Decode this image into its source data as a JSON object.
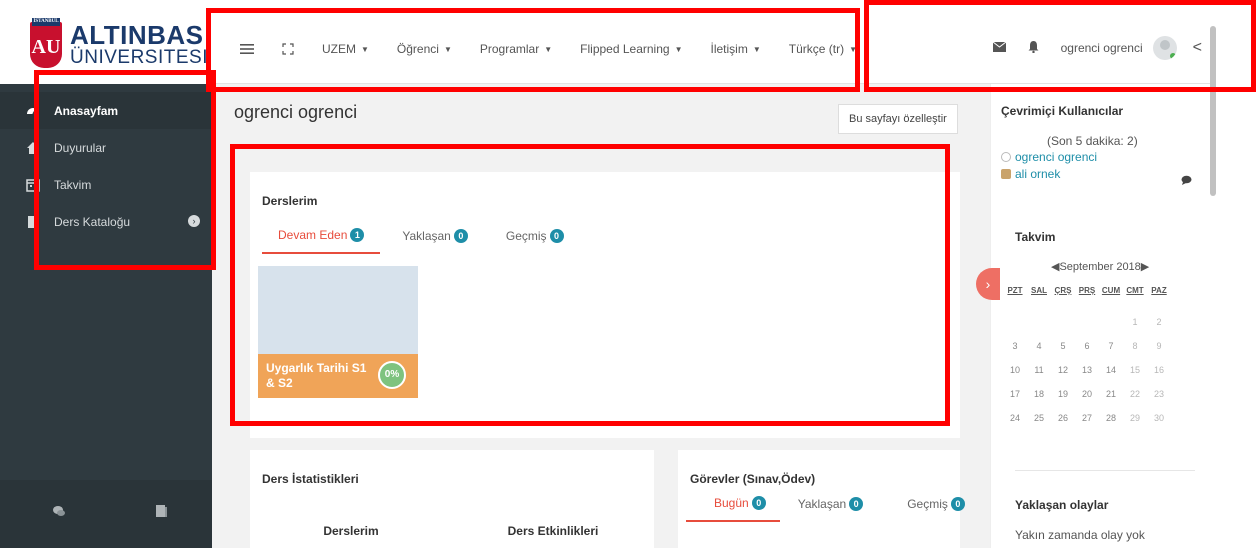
{
  "brand": {
    "name": "ALTINBAS",
    "sub": "ÜNIVERSITESI",
    "mark": "AU",
    "crown": "İSTANBUL"
  },
  "sidebar": {
    "items": [
      {
        "label": "Anasayfam",
        "icon": "dashboard-icon",
        "active": true
      },
      {
        "label": "Duyurular",
        "icon": "home-icon",
        "active": false
      },
      {
        "label": "Takvim",
        "icon": "calendar-icon",
        "active": false
      },
      {
        "label": "Ders Kataloğu",
        "icon": "book-icon",
        "active": false
      }
    ]
  },
  "topbar": {
    "menu": [
      "UZEM",
      "Öğrenci",
      "Programlar",
      "Flipped Learning",
      "İletişim",
      "Türkçe (tr)"
    ],
    "username": "ogrenci ogrenci"
  },
  "main": {
    "title": "ogrenci ogrenci",
    "customize_label": "Bu sayfayı özelleştir",
    "courses": {
      "title": "Derslerim",
      "tabs": [
        {
          "label": "Devam Eden",
          "count": "1",
          "active": true
        },
        {
          "label": "Yaklaşan",
          "count": "0",
          "active": false
        },
        {
          "label": "Geçmiş",
          "count": "0",
          "active": false
        }
      ],
      "cards": [
        {
          "name": "Uygarlık Tarihi S1 & S2",
          "progress": "0%"
        }
      ]
    },
    "stats": {
      "title": "Ders İstatistikleri",
      "col1": "Derslerim",
      "col2": "Ders Etkinlikleri"
    },
    "tasks": {
      "title": "Görevler (Sınav,Ödev)",
      "tabs": [
        {
          "label": "Bugün",
          "count": "0",
          "active": true
        },
        {
          "label": "Yaklaşan",
          "count": "0",
          "active": false
        },
        {
          "label": "Geçmiş",
          "count": "0",
          "active": false
        }
      ]
    }
  },
  "right": {
    "online": {
      "title": "Çevrimiçi Kullanıcılar",
      "subtitle": "(Son 5 dakika: 2)",
      "users": [
        "ogrenci ogrenci",
        "ali ornek"
      ]
    },
    "calendar": {
      "title": "Takvim",
      "month": "◀September 2018▶",
      "days": [
        "PZT",
        "SAL",
        "ÇRŞ",
        "PRŞ",
        "CUM",
        "CMT",
        "PAZ"
      ],
      "weeks": [
        [
          "",
          "",
          "",
          "",
          "",
          "1",
          "2"
        ],
        [
          "3",
          "4",
          "5",
          "6",
          "7",
          "8",
          "9"
        ],
        [
          "10",
          "11",
          "12",
          "13",
          "14",
          "15",
          "16"
        ],
        [
          "17",
          "18",
          "19",
          "20",
          "21",
          "22",
          "23"
        ],
        [
          "24",
          "25",
          "26",
          "27",
          "28",
          "29",
          "30"
        ]
      ]
    },
    "upcoming": {
      "title": "Yaklaşan olaylar",
      "empty": "Yakın zamanda olay yok"
    }
  },
  "colors": {
    "accent": "#e74c3c",
    "badge": "#1e8ea8",
    "sidebar": "#2f3a40",
    "annotation": "#ff0000"
  }
}
